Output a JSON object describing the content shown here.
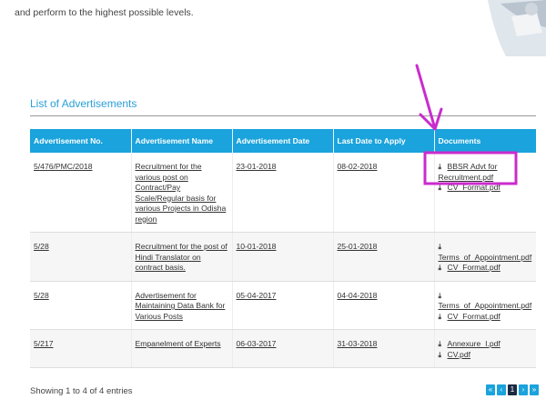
{
  "intro_text": "and perform to the highest possible levels.",
  "section_title": "List of Advertisements",
  "table": {
    "headers": [
      "Advertisement No.",
      "Advertisement Name",
      "Advertisement Date",
      "Last Date to Apply",
      "Documents"
    ],
    "rows": [
      {
        "number": "5/476/PMC/2018",
        "name": "Recruitment for the various post on Contract/Pay Scale/Regular basis for various Projects in Odisha region",
        "date": "23-01-2018",
        "last_date": "08-02-2018",
        "documents": [
          "BBSR Advt for Recruitment.pdf",
          "CV_Format.pdf"
        ]
      },
      {
        "number": "5/28",
        "name": "Recruitment for the post of Hindi Translator on contract basis.",
        "date": "10-01-2018",
        "last_date": "25-01-2018",
        "documents": [
          "Terms_of_Appointment.pdf",
          "CV_Format.pdf"
        ]
      },
      {
        "number": "5/28",
        "name": "Advertisement for Maintaining Data Bank for Various Posts",
        "date": "05-04-2017",
        "last_date": "04-04-2018",
        "documents": [
          "Terms_of_Appointment.pdf",
          "CV_Format.pdf"
        ]
      },
      {
        "number": "5/217",
        "name": "Empanelment of Experts",
        "date": "06-03-2017",
        "last_date": "31-03-2018",
        "documents": [
          "Annexure_I.pdf",
          "CV.pdf"
        ]
      }
    ]
  },
  "footer": {
    "entries_info": "Showing 1 to 4 of 4 entries",
    "pagination": [
      "«",
      "‹",
      "1",
      "›",
      "»"
    ],
    "current_page": "1"
  },
  "colors": {
    "header_bg": "#1aa3dc",
    "title": "#2a9fd8",
    "annotation": "#c92ccd",
    "pager_active": "#1b2a44"
  },
  "icons": {
    "download": "download-icon"
  }
}
